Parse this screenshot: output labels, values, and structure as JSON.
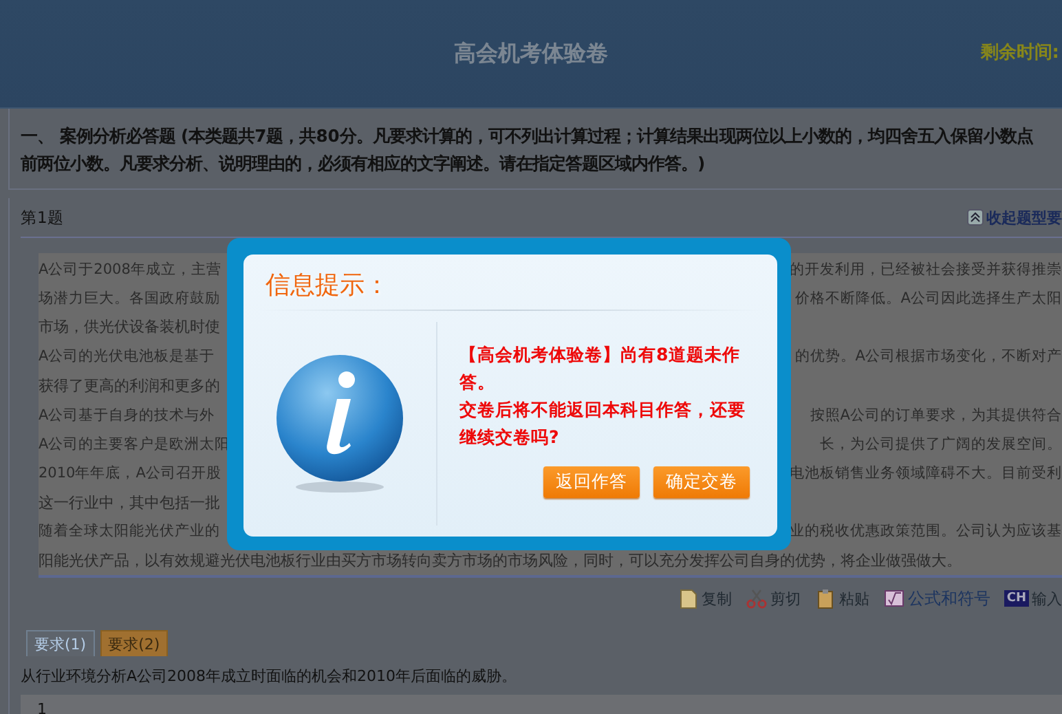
{
  "header": {
    "title": "高会机考体验卷",
    "timer_label": "剩余时间:"
  },
  "instructions": [
    "一、 案例分析必答题 (本类题共7题，共80分。凡要求计算的，可不列出计算过程；计算结果出现两位以上小数的，均四舍五入保留小数点",
    "前两位小数。凡要求分析、说明理由的，必须有相应的文字阐述。请在指定答题区域内作答。)"
  ],
  "question": {
    "label": "第1题",
    "collapse_link": "收起题型要",
    "passage": [
      {
        "left": "A公司于2008年成立，主营",
        "right": "的开发利用，已经被社会接受并获得推崇"
      },
      {
        "left": "场潜力巨大。各国政府鼓励",
        "right": "价格不断降低。A公司因此选择生产太阳"
      },
      {
        "left": "市场，供光伏设备装机时使"
      },
      {
        "left": "A公司的光伏电池板是基于",
        "right": "的优势。A公司根据市场变化，不断对产"
      },
      {
        "left": "获得了更高的利润和更多的"
      },
      {
        "left": "A公司基于自身的技术与外",
        "right": "按照A公司的订单要求，为其提供符合"
      },
      {
        "left": "A公司的主要客户是欧洲太阳",
        "right": "长，为公司提供了广阔的发展空间。"
      },
      {
        "left": "2010年年底，A公司召开股",
        "right": "电池板销售业务领域障碍不大。目前受利"
      },
      {
        "left": "这一行业中，其中包括一批"
      },
      {
        "left": "随着全球太阳能光伏产业的",
        "right": "业的税收优惠政策范围。公司认为应该基"
      },
      {
        "left": "阳能光伏产品，以有效规避光伏电池板行业由买方市场转向卖方市场的市场风险，同时，可以充分发挥公司自身的优势，将企业做强做大。"
      }
    ],
    "toolbar": [
      {
        "kind": "copy",
        "label": "复制"
      },
      {
        "kind": "cut",
        "label": "剪切"
      },
      {
        "kind": "paste",
        "label": "粘贴"
      },
      {
        "kind": "formula",
        "label": "公式和符号"
      },
      {
        "kind": "ime",
        "label": "输入",
        "badge": "CH"
      }
    ],
    "tabs": [
      {
        "label": "要求(1)",
        "selected": false
      },
      {
        "label": "要求(2)",
        "selected": true
      }
    ],
    "prompt": "从行业环境分析A公司2008年成立时面临的机会和2010年后面临的威胁。",
    "answer": "1"
  },
  "dialog": {
    "title": "信息提示：",
    "message": [
      "【高会机考体验卷】尚有8道题未作答。",
      "交卷后将不能返回本科目作答，还要继续交卷吗?"
    ],
    "buttons": [
      "返回作答",
      "确定交卷"
    ]
  }
}
